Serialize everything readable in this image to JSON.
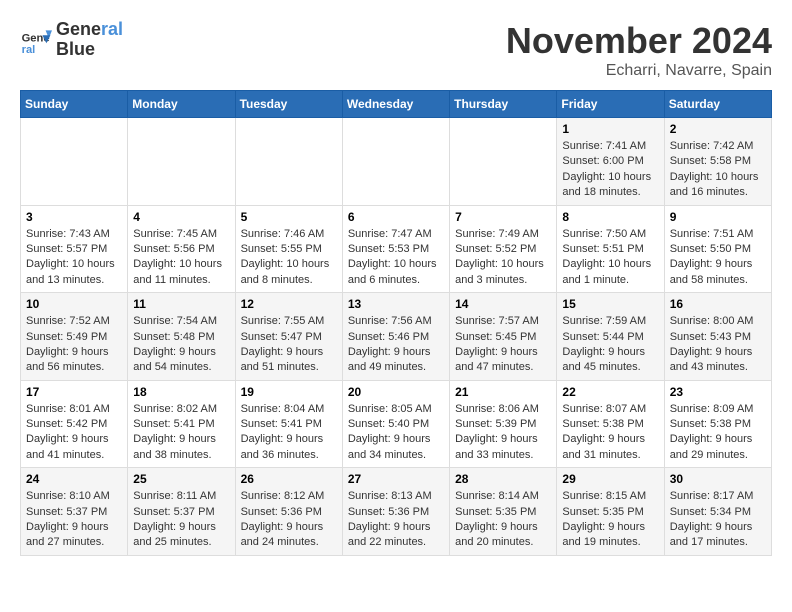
{
  "header": {
    "logo_line1": "General",
    "logo_line2": "Blue",
    "month": "November 2024",
    "location": "Echarri, Navarre, Spain"
  },
  "days_of_week": [
    "Sunday",
    "Monday",
    "Tuesday",
    "Wednesday",
    "Thursday",
    "Friday",
    "Saturday"
  ],
  "weeks": [
    [
      {
        "day": "",
        "info": ""
      },
      {
        "day": "",
        "info": ""
      },
      {
        "day": "",
        "info": ""
      },
      {
        "day": "",
        "info": ""
      },
      {
        "day": "",
        "info": ""
      },
      {
        "day": "1",
        "info": "Sunrise: 7:41 AM\nSunset: 6:00 PM\nDaylight: 10 hours and 18 minutes."
      },
      {
        "day": "2",
        "info": "Sunrise: 7:42 AM\nSunset: 5:58 PM\nDaylight: 10 hours and 16 minutes."
      }
    ],
    [
      {
        "day": "3",
        "info": "Sunrise: 7:43 AM\nSunset: 5:57 PM\nDaylight: 10 hours and 13 minutes."
      },
      {
        "day": "4",
        "info": "Sunrise: 7:45 AM\nSunset: 5:56 PM\nDaylight: 10 hours and 11 minutes."
      },
      {
        "day": "5",
        "info": "Sunrise: 7:46 AM\nSunset: 5:55 PM\nDaylight: 10 hours and 8 minutes."
      },
      {
        "day": "6",
        "info": "Sunrise: 7:47 AM\nSunset: 5:53 PM\nDaylight: 10 hours and 6 minutes."
      },
      {
        "day": "7",
        "info": "Sunrise: 7:49 AM\nSunset: 5:52 PM\nDaylight: 10 hours and 3 minutes."
      },
      {
        "day": "8",
        "info": "Sunrise: 7:50 AM\nSunset: 5:51 PM\nDaylight: 10 hours and 1 minute."
      },
      {
        "day": "9",
        "info": "Sunrise: 7:51 AM\nSunset: 5:50 PM\nDaylight: 9 hours and 58 minutes."
      }
    ],
    [
      {
        "day": "10",
        "info": "Sunrise: 7:52 AM\nSunset: 5:49 PM\nDaylight: 9 hours and 56 minutes."
      },
      {
        "day": "11",
        "info": "Sunrise: 7:54 AM\nSunset: 5:48 PM\nDaylight: 9 hours and 54 minutes."
      },
      {
        "day": "12",
        "info": "Sunrise: 7:55 AM\nSunset: 5:47 PM\nDaylight: 9 hours and 51 minutes."
      },
      {
        "day": "13",
        "info": "Sunrise: 7:56 AM\nSunset: 5:46 PM\nDaylight: 9 hours and 49 minutes."
      },
      {
        "day": "14",
        "info": "Sunrise: 7:57 AM\nSunset: 5:45 PM\nDaylight: 9 hours and 47 minutes."
      },
      {
        "day": "15",
        "info": "Sunrise: 7:59 AM\nSunset: 5:44 PM\nDaylight: 9 hours and 45 minutes."
      },
      {
        "day": "16",
        "info": "Sunrise: 8:00 AM\nSunset: 5:43 PM\nDaylight: 9 hours and 43 minutes."
      }
    ],
    [
      {
        "day": "17",
        "info": "Sunrise: 8:01 AM\nSunset: 5:42 PM\nDaylight: 9 hours and 41 minutes."
      },
      {
        "day": "18",
        "info": "Sunrise: 8:02 AM\nSunset: 5:41 PM\nDaylight: 9 hours and 38 minutes."
      },
      {
        "day": "19",
        "info": "Sunrise: 8:04 AM\nSunset: 5:41 PM\nDaylight: 9 hours and 36 minutes."
      },
      {
        "day": "20",
        "info": "Sunrise: 8:05 AM\nSunset: 5:40 PM\nDaylight: 9 hours and 34 minutes."
      },
      {
        "day": "21",
        "info": "Sunrise: 8:06 AM\nSunset: 5:39 PM\nDaylight: 9 hours and 33 minutes."
      },
      {
        "day": "22",
        "info": "Sunrise: 8:07 AM\nSunset: 5:38 PM\nDaylight: 9 hours and 31 minutes."
      },
      {
        "day": "23",
        "info": "Sunrise: 8:09 AM\nSunset: 5:38 PM\nDaylight: 9 hours and 29 minutes."
      }
    ],
    [
      {
        "day": "24",
        "info": "Sunrise: 8:10 AM\nSunset: 5:37 PM\nDaylight: 9 hours and 27 minutes."
      },
      {
        "day": "25",
        "info": "Sunrise: 8:11 AM\nSunset: 5:37 PM\nDaylight: 9 hours and 25 minutes."
      },
      {
        "day": "26",
        "info": "Sunrise: 8:12 AM\nSunset: 5:36 PM\nDaylight: 9 hours and 24 minutes."
      },
      {
        "day": "27",
        "info": "Sunrise: 8:13 AM\nSunset: 5:36 PM\nDaylight: 9 hours and 22 minutes."
      },
      {
        "day": "28",
        "info": "Sunrise: 8:14 AM\nSunset: 5:35 PM\nDaylight: 9 hours and 20 minutes."
      },
      {
        "day": "29",
        "info": "Sunrise: 8:15 AM\nSunset: 5:35 PM\nDaylight: 9 hours and 19 minutes."
      },
      {
        "day": "30",
        "info": "Sunrise: 8:17 AM\nSunset: 5:34 PM\nDaylight: 9 hours and 17 minutes."
      }
    ]
  ]
}
